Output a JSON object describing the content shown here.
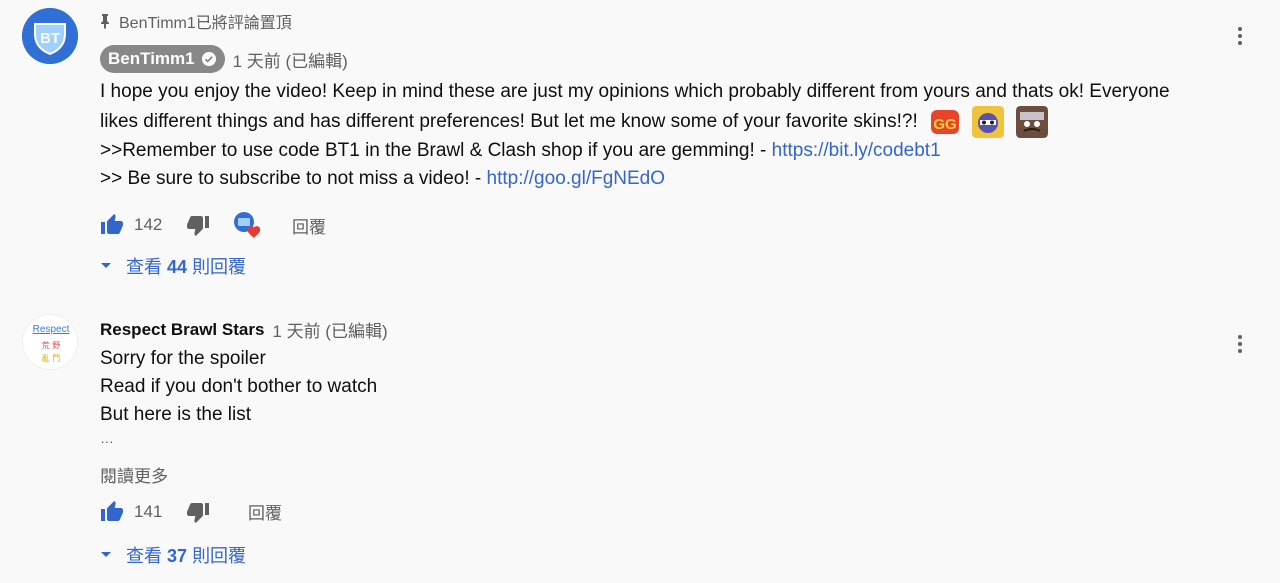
{
  "comments": [
    {
      "pinned_label": "BenTimm1已將評論置頂",
      "author": "BenTimm1",
      "verified": true,
      "time": "1 天前 (已編輯)",
      "text_line1": "I hope you enjoy the video! Keep in mind these are just my opinions which probably different from yours and thats ok! Everyone likes different things and has different preferences! But let me know some of your favorite skins!?!",
      "text_line3_prefix": ">>Remember to use code BT1 in the Brawl & Clash shop if you are gemming! - ",
      "text_line3_link": "https://bit.ly/codebt1",
      "text_line4_prefix": ">> Be sure to subscribe to not miss a video! - ",
      "text_line4_link": "http://goo.gl/FgNEdO",
      "likes": "142",
      "reply_label": "回覆",
      "replies_prefix": "查看",
      "replies_count": "44",
      "replies_suffix": "則回覆",
      "emojis": [
        "gg-emoji",
        "brawler-emoji-1",
        "brawler-emoji-2"
      ]
    },
    {
      "author": "Respect Brawl Stars",
      "avatar_text_line1": "Respect",
      "avatar_text_line2": "荒 野",
      "avatar_text_line3": "亂 鬥",
      "time": "1 天前 (已編輯)",
      "line1": "Sorry for the spoiler",
      "line2": "Read if you don't bother to watch",
      "line3": "But here is the list",
      "ellipsis": "…",
      "read_more": "閱讀更多",
      "likes": "141",
      "reply_label": "回覆",
      "replies_prefix": "查看",
      "replies_count": "37",
      "replies_suffix": "則回覆"
    }
  ],
  "colors": {
    "link": "#3366cc",
    "secondary_text": "#606060",
    "owner_badge": "#888888",
    "heart": "#e53935"
  }
}
